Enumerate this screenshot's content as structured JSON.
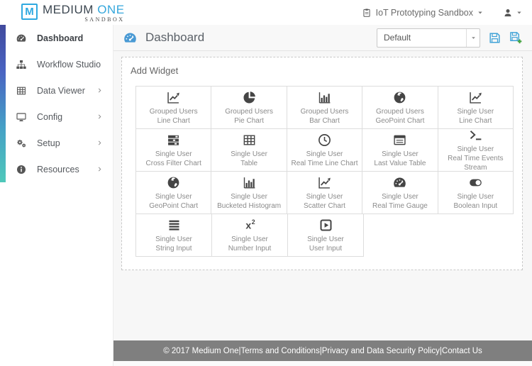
{
  "brand": {
    "logo_letter": "M",
    "name_primary": "MEDIUM",
    "name_accent": "ONE",
    "subtitle": "SANDBOX"
  },
  "topbar": {
    "project_selector": {
      "label": "IoT Prototyping Sandbox",
      "icon": "clipboard-icon"
    },
    "user_menu": {
      "icon": "user-icon"
    }
  },
  "sidebar": {
    "items": [
      {
        "label": "Dashboard",
        "icon": "gauge-icon",
        "active": true,
        "has_submenu": false
      },
      {
        "label": "Workflow Studio",
        "icon": "sitemap-icon",
        "active": false,
        "has_submenu": false
      },
      {
        "label": "Data Viewer",
        "icon": "table-icon",
        "active": false,
        "has_submenu": true
      },
      {
        "label": "Config",
        "icon": "desktop-icon",
        "active": false,
        "has_submenu": true
      },
      {
        "label": "Setup",
        "icon": "cogs-icon",
        "active": false,
        "has_submenu": true
      },
      {
        "label": "Resources",
        "icon": "info-icon",
        "active": false,
        "has_submenu": true
      }
    ]
  },
  "header": {
    "title": "Dashboard",
    "icon": "gauge-icon",
    "dashboard_select": {
      "value": "Default"
    },
    "save_icon": "save-icon",
    "save_as_icon": "save-as-icon"
  },
  "panel": {
    "title": "Add Widget",
    "columns": 5,
    "widgets": [
      {
        "line1": "Grouped Users",
        "line2": "Line Chart",
        "icon": "line-chart-icon"
      },
      {
        "line1": "Grouped Users",
        "line2": "Pie Chart",
        "icon": "pie-chart-icon"
      },
      {
        "line1": "Grouped Users",
        "line2": "Bar Chart",
        "icon": "bar-chart-icon"
      },
      {
        "line1": "Grouped Users",
        "line2": "GeoPoint Chart",
        "icon": "globe-icon"
      },
      {
        "line1": "Single User",
        "line2": "Line Chart",
        "icon": "line-chart-icon"
      },
      {
        "line1": "Single User",
        "line2": "Cross Filter Chart",
        "icon": "tasks-icon"
      },
      {
        "line1": "Single User",
        "line2": "Table",
        "icon": "table-icon"
      },
      {
        "line1": "Single User",
        "line2": "Real Time Line Chart",
        "icon": "clock-icon"
      },
      {
        "line1": "Single User",
        "line2": "Last Value Table",
        "icon": "list-alt-icon"
      },
      {
        "line1": "Single User",
        "line2": "Real Time Events Stream",
        "icon": "terminal-icon"
      },
      {
        "line1": "Single User",
        "line2": "GeoPoint Chart",
        "icon": "globe-icon"
      },
      {
        "line1": "Single User",
        "line2": "Bucketed Histogram",
        "icon": "bar-chart-icon"
      },
      {
        "line1": "Single User",
        "line2": "Scatter Chart",
        "icon": "line-chart-icon"
      },
      {
        "line1": "Single User",
        "line2": "Real Time Gauge",
        "icon": "gauge-icon"
      },
      {
        "line1": "Single User",
        "line2": "Boolean Input",
        "icon": "toggle-icon"
      },
      {
        "line1": "Single User",
        "line2": "String Input",
        "icon": "align-justify-icon"
      },
      {
        "line1": "Single User",
        "line2": "Number Input",
        "icon": "x2-icon"
      },
      {
        "line1": "Single User",
        "line2": "User Input",
        "icon": "play-square-icon"
      }
    ]
  },
  "footer": {
    "copyright": "© 2017 Medium One",
    "separator": " | ",
    "links": [
      "Terms and Conditions",
      "Privacy and Data Security Policy",
      "Contact Us"
    ]
  },
  "colors": {
    "accent_blue": "#2fa9e0",
    "header_icon_blue": "#4a9ad4",
    "save_green": "#44a340",
    "strip_gradient_top": "#414a9d",
    "strip_gradient_bottom": "#4fc8ba",
    "footer_bg": "#7f7f7f"
  }
}
